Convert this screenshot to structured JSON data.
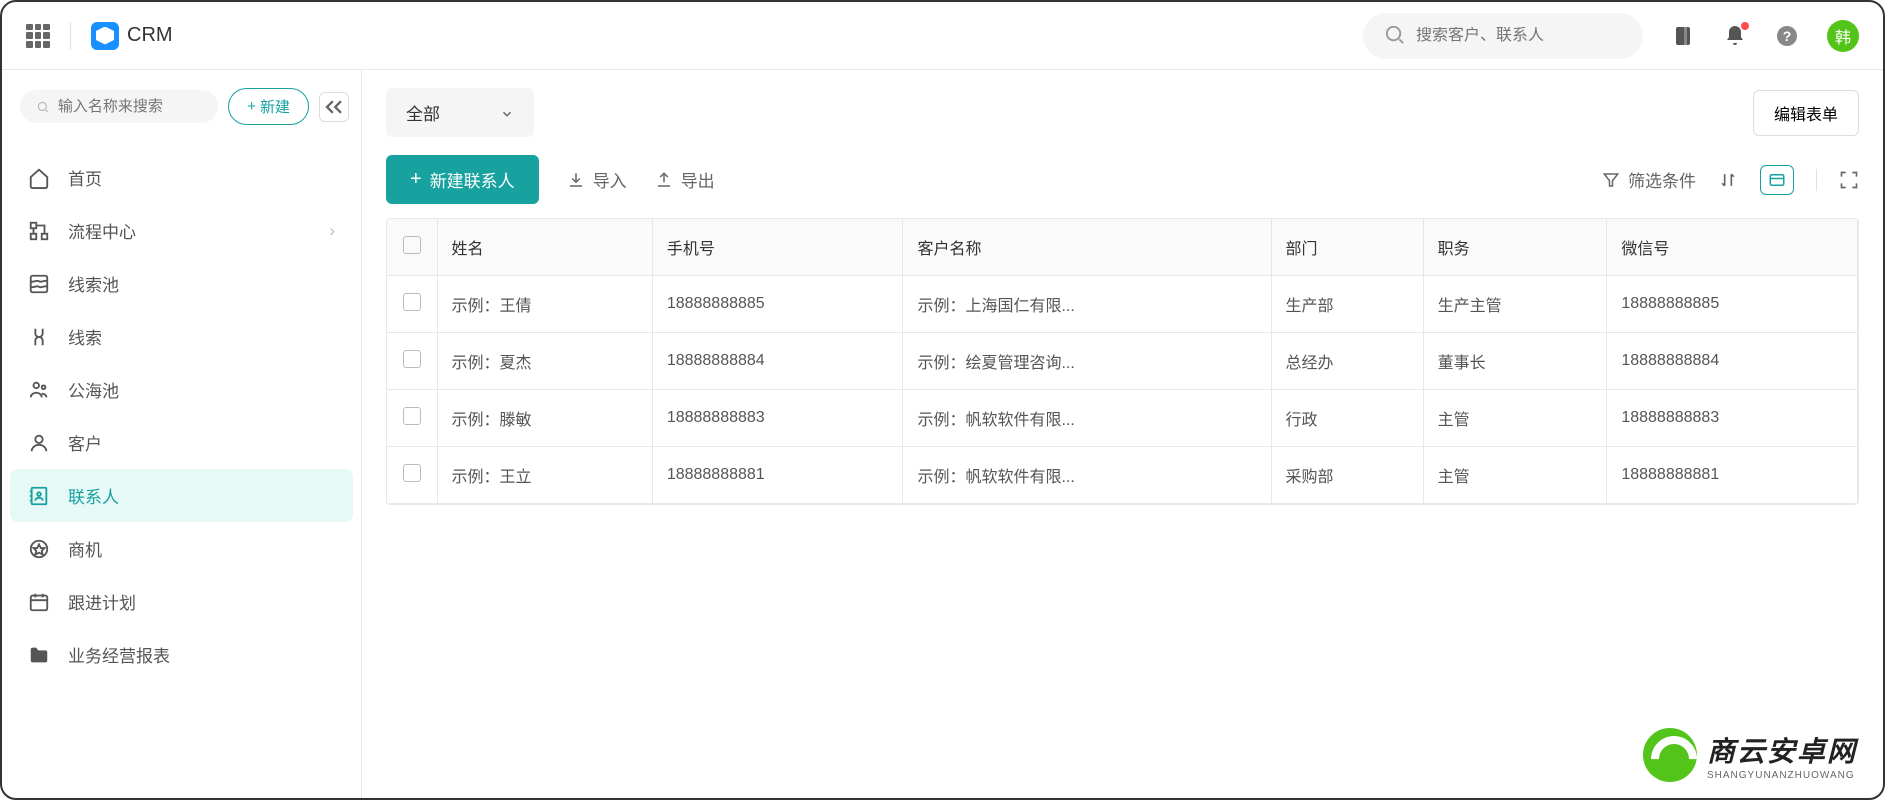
{
  "header": {
    "app_name": "CRM",
    "search_placeholder": "搜索客户、联系人",
    "avatar_text": "韩"
  },
  "sidebar": {
    "search_placeholder": "输入名称来搜索",
    "new_button": "新建",
    "items": [
      {
        "label": "首页",
        "icon": "home"
      },
      {
        "label": "流程中心",
        "icon": "flowchart",
        "has_chevron": true
      },
      {
        "label": "线索池",
        "icon": "pool"
      },
      {
        "label": "线索",
        "icon": "link"
      },
      {
        "label": "公海池",
        "icon": "public"
      },
      {
        "label": "客户",
        "icon": "person"
      },
      {
        "label": "联系人",
        "icon": "contacts",
        "active": true
      },
      {
        "label": "商机",
        "icon": "opportunity"
      },
      {
        "label": "跟进计划",
        "icon": "calendar"
      },
      {
        "label": "业务经营报表",
        "icon": "folder"
      }
    ]
  },
  "main": {
    "filter_selected": "全部",
    "edit_form_button": "编辑表单",
    "new_contact_button": "新建联系人",
    "import_button": "导入",
    "export_button": "导出",
    "filter_button": "筛选条件"
  },
  "table": {
    "columns": [
      "姓名",
      "手机号",
      "客户名称",
      "部门",
      "职务",
      "微信号"
    ],
    "rows": [
      {
        "name": "示例：王倩",
        "phone": "18888888885",
        "customer": "示例：上海国仁有限...",
        "dept": "生产部",
        "position": "生产主管",
        "wechat": "18888888885"
      },
      {
        "name": "示例：夏杰",
        "phone": "18888888884",
        "customer": "示例：绘夏管理咨询...",
        "dept": "总经办",
        "position": "董事长",
        "wechat": "18888888884"
      },
      {
        "name": "示例：滕敏",
        "phone": "18888888883",
        "customer": "示例：帆软软件有限...",
        "dept": "行政",
        "position": "主管",
        "wechat": "18888888883"
      },
      {
        "name": "示例：王立",
        "phone": "18888888881",
        "customer": "示例：帆软软件有限...",
        "dept": "采购部",
        "position": "主管",
        "wechat": "18888888881"
      }
    ]
  },
  "watermark": {
    "title": "商云安卓网",
    "sub": "SHANGYUNANZHUOWANG"
  }
}
